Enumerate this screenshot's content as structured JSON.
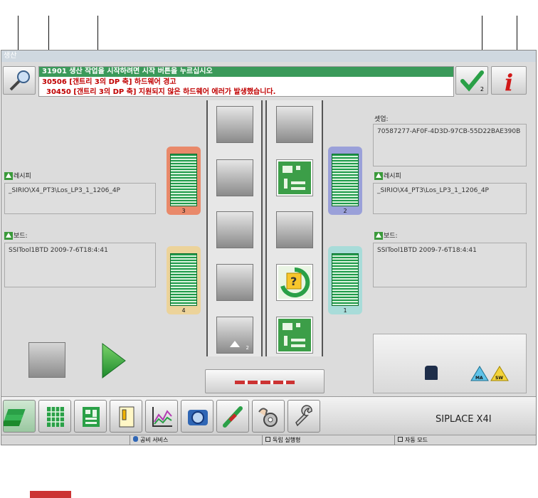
{
  "window": {
    "title": "생산"
  },
  "messages": [
    {
      "code": "31901",
      "text": "생산 작업을 시작하려면 시작 버튼을 누르십시오"
    },
    {
      "code": "30506",
      "text": "[갠트리 3의 DP 축] 하드웨어 경고"
    },
    {
      "code": "30450",
      "text": "[갠트리 3의 DP 축] 지원되지 않은 하드웨어 에러가 발생했습니다."
    }
  ],
  "check_button": {
    "count": "2"
  },
  "left": {
    "recipe_label": "레시피",
    "recipe_value": "_SIRIO\\X4_PT3\\Los_LP3_1_1206_4P",
    "board_label": "보드:",
    "board_value": "SSITool1BTD 2009-7-6T18:4:41"
  },
  "right": {
    "setup_label": "셋업:",
    "setup_value": "70587277-AF0F-4D3D-97CB-55D22BAE390B",
    "recipe_label": "레시피",
    "recipe_value": "_SIRIO\\X4_PT3\\Los_LP3_1_1206_4P",
    "board_label": "보드:",
    "board_value": "SSITool1BTD 2009-7-6T18:4:41"
  },
  "feeders": [
    {
      "num": "3",
      "color": "#e9896a"
    },
    {
      "num": "4",
      "color": "#ecd39a"
    },
    {
      "num": "2",
      "color": "#9aa0d9"
    },
    {
      "num": "1",
      "color": "#a8dcd9"
    }
  ],
  "conveyor": {
    "slot_count": "2"
  },
  "status_icons": {
    "ma": "MA",
    "sw": "SW"
  },
  "brand": "SIPLACE X4I",
  "toolbar_icons": [
    "production-icon",
    "grid-icon",
    "board-icon",
    "document-icon",
    "chart-icon",
    "camera-icon",
    "tool-pen-icon",
    "gear-hand-icon",
    "wrench-icon"
  ],
  "statusbar": {
    "service": "공비 서비스",
    "production": "독립 실행형",
    "mode": "자동 모드"
  },
  "colors": {
    "msg_green": "#3b9a5a",
    "msg_red": "#c00000",
    "accent_green": "#2aa047"
  }
}
